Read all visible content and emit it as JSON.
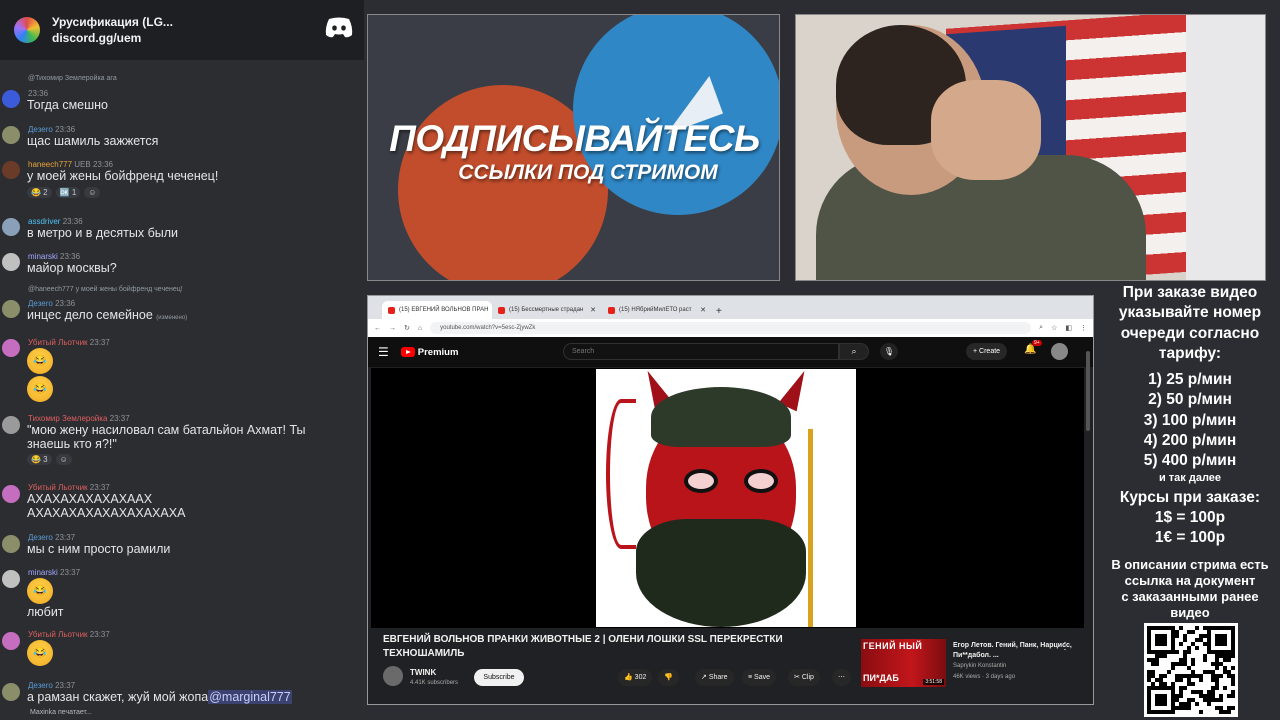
{
  "chat": {
    "server_title": "Урусификация (LG...",
    "invite": "discord.gg/uem",
    "typing": "Maxinka печатает...",
    "messages": [
      {
        "reply": "@Тихомир Землеройка ага",
        "time": "23:36",
        "author": "",
        "text": "Тогда смешно",
        "color": "#a3a6ff"
      },
      {
        "author": "Дезеrо",
        "time": "23:36",
        "text": "щас шамиль зажжется",
        "color": "#5b9bd5"
      },
      {
        "author": "haneech777",
        "badge": "UEB",
        "time": "23:36",
        "text": "у моей жены бойфренд чеченец!",
        "color": "#e8a33b",
        "reactions": [
          "😂 2",
          "🆗 1",
          "☺"
        ]
      },
      {
        "author": "assdriver",
        "time": "23:36",
        "text": "в метро и в десятых были",
        "color": "#4fc3f7"
      },
      {
        "author": "minarski",
        "time": "23:36",
        "text": "майор москвы?",
        "color": "#a3a6ff"
      },
      {
        "reply": "@haneech777 у моей жены бойфренд чеченец!",
        "author": "Дезеrо",
        "time": "23:36",
        "text": "инцес дело семейное",
        "edited": "(изменено)",
        "color": "#5b9bd5"
      },
      {
        "author": "Убитый Льотчик",
        "time": "23:37",
        "text": "",
        "color": "#e05f5f",
        "emojis": [
          "😂",
          "😂"
        ]
      },
      {
        "author": "Тихомир Землеройка",
        "time": "23:37",
        "text": "\"мою жену насиловал сам батальйон Ахмат! Ты",
        "text2": "знаешь кто я?!\"",
        "color": "#e05f5f",
        "reactions": [
          "😂 3",
          "☺"
        ]
      },
      {
        "author": "Убитый Льотчик",
        "time": "23:37",
        "text": "АХАХАХАХАХАХААХ",
        "text2": "АХАХАХАХАХАХАХАХАХА",
        "color": "#e05f5f"
      },
      {
        "author": "Дезеrо",
        "time": "23:37",
        "text": "мы с ним просто рамили",
        "color": "#5b9bd5"
      },
      {
        "author": "minarski",
        "time": "23:37",
        "text": "любит",
        "color": "#a3a6ff",
        "emojis": [
          "😂"
        ]
      },
      {
        "author": "Убитый Льотчик",
        "time": "23:37",
        "text": "",
        "color": "#e05f5f",
        "emojis": [
          "😂"
        ]
      },
      {
        "author": "Дезеrо",
        "time": "23:37",
        "text": "а рамзан скажет, жуй мой жопа",
        "mention": "@marginal777",
        "color": "#5b9bd5"
      }
    ]
  },
  "promo": {
    "headline": "ПОДПИСЫВАЙТЕСЬ",
    "subline": "ССЫЛКИ ПОД СТРИМОМ"
  },
  "browser": {
    "tabs": [
      "(15) ЕВГЕНИЙ ВОЛЬНОВ ПРАН",
      "(15) Бессмертные страдан",
      "(15) НЯбрийМилЕТО раст"
    ],
    "url": "youtube.com/watch?v=5esc-ZjywZk",
    "yt": {
      "brand": "Premium",
      "search_placeholder": "Search",
      "create": "Create",
      "notif_badge": "9+"
    },
    "video": {
      "title_line1": "ЕВГЕНИЙ ВОЛЬНОВ ПРАНКИ ЖИВОТНЫЕ 2 | ОЛЕНИ ЛОШКИ SSL ПЕРЕКРЕСТКИ",
      "title_line2": "ТЕХНОШАМИЛЬ",
      "channel": "TWINK",
      "subs": "4.41K subscribers",
      "subscribe": "Subscribe",
      "likes": "302",
      "share": "Share",
      "save": "Save",
      "clip": "Clip"
    },
    "recommended": {
      "thumb_top": "ГЕНИЙ НЫЙ",
      "thumb_bottom": "ПИ*ДАБ",
      "duration": "3:51:58",
      "title": "Егор Летов. Гений, Панк, Нарцисс, Пи**дабол. ...",
      "channel": "Saprykin Konstantin",
      "views": "46K views · 3 days ago"
    }
  },
  "info": {
    "intro": [
      "При заказе видео",
      "указывайте номер",
      "очереди согласно",
      "тарифу:"
    ],
    "tariffs": [
      "1) 25 р/мин",
      "2) 50 р/мин",
      "3) 100 р/мин",
      "4) 200 р/мин",
      "5) 400 р/мин"
    ],
    "etc": "и так далее",
    "rates_title": "Курсы при заказе:",
    "rates": [
      "1$ = 100р",
      "1€ = 100р"
    ],
    "note": [
      "В описании стрима есть",
      "ссылка на документ",
      "с заказанными ранее",
      "видео"
    ]
  },
  "colors": {
    "accent_red": "#ff0000",
    "discord_dark": "#1e1f22",
    "chat_bg": "#2b2d31"
  }
}
